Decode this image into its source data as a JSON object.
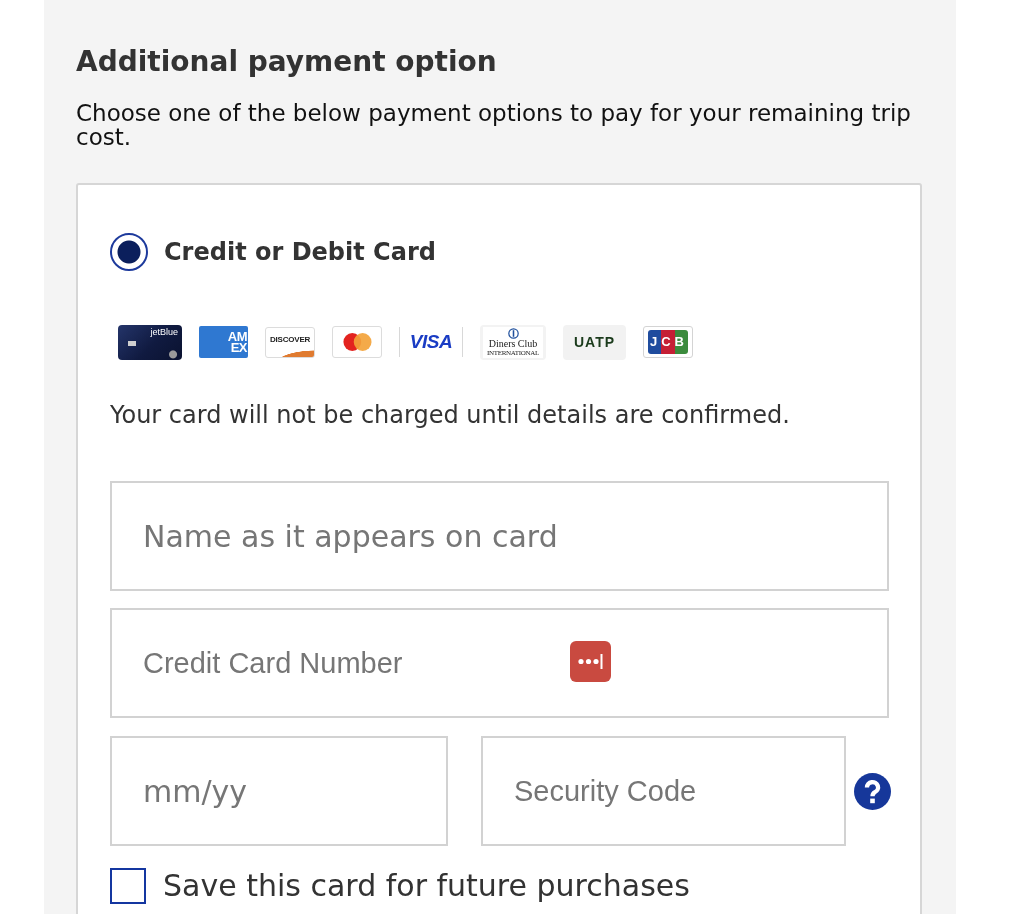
{
  "panel": {
    "title": "Additional payment option",
    "description": "Choose one of the below payment options to pay for your remaining trip cost."
  },
  "payment_methods": [
    {
      "label": "Credit or Debit Card",
      "selected": true
    }
  ],
  "card_logos": [
    {
      "kind": "cobrand",
      "lines": [
        "jetBlue"
      ]
    },
    {
      "kind": "amex",
      "lines": [
        "AM",
        "EX"
      ]
    },
    {
      "kind": "discover",
      "lines": [
        "DISCOVER"
      ]
    },
    {
      "kind": "mastercard"
    },
    {
      "kind": "visa",
      "lines": [
        "VISA"
      ]
    },
    {
      "kind": "diners",
      "lines": [
        "Diners Club",
        "INTERNATIONAL"
      ]
    },
    {
      "kind": "uatp",
      "lines": [
        "UATP"
      ]
    },
    {
      "kind": "jcb",
      "lines": [
        "JCB"
      ]
    }
  ],
  "notice": "Your card will not be charged until details are confirmed.",
  "name_field": {
    "placeholder": "Name as it appears on card"
  },
  "card_number_field": {
    "placeholder": "Credit Card Number"
  },
  "expiry_field": {
    "placeholder": "mm/yy"
  },
  "security_code_field": {
    "placeholder": "Security Code"
  },
  "save_card": {
    "label": "Save this card for future purchases",
    "checked": false
  }
}
